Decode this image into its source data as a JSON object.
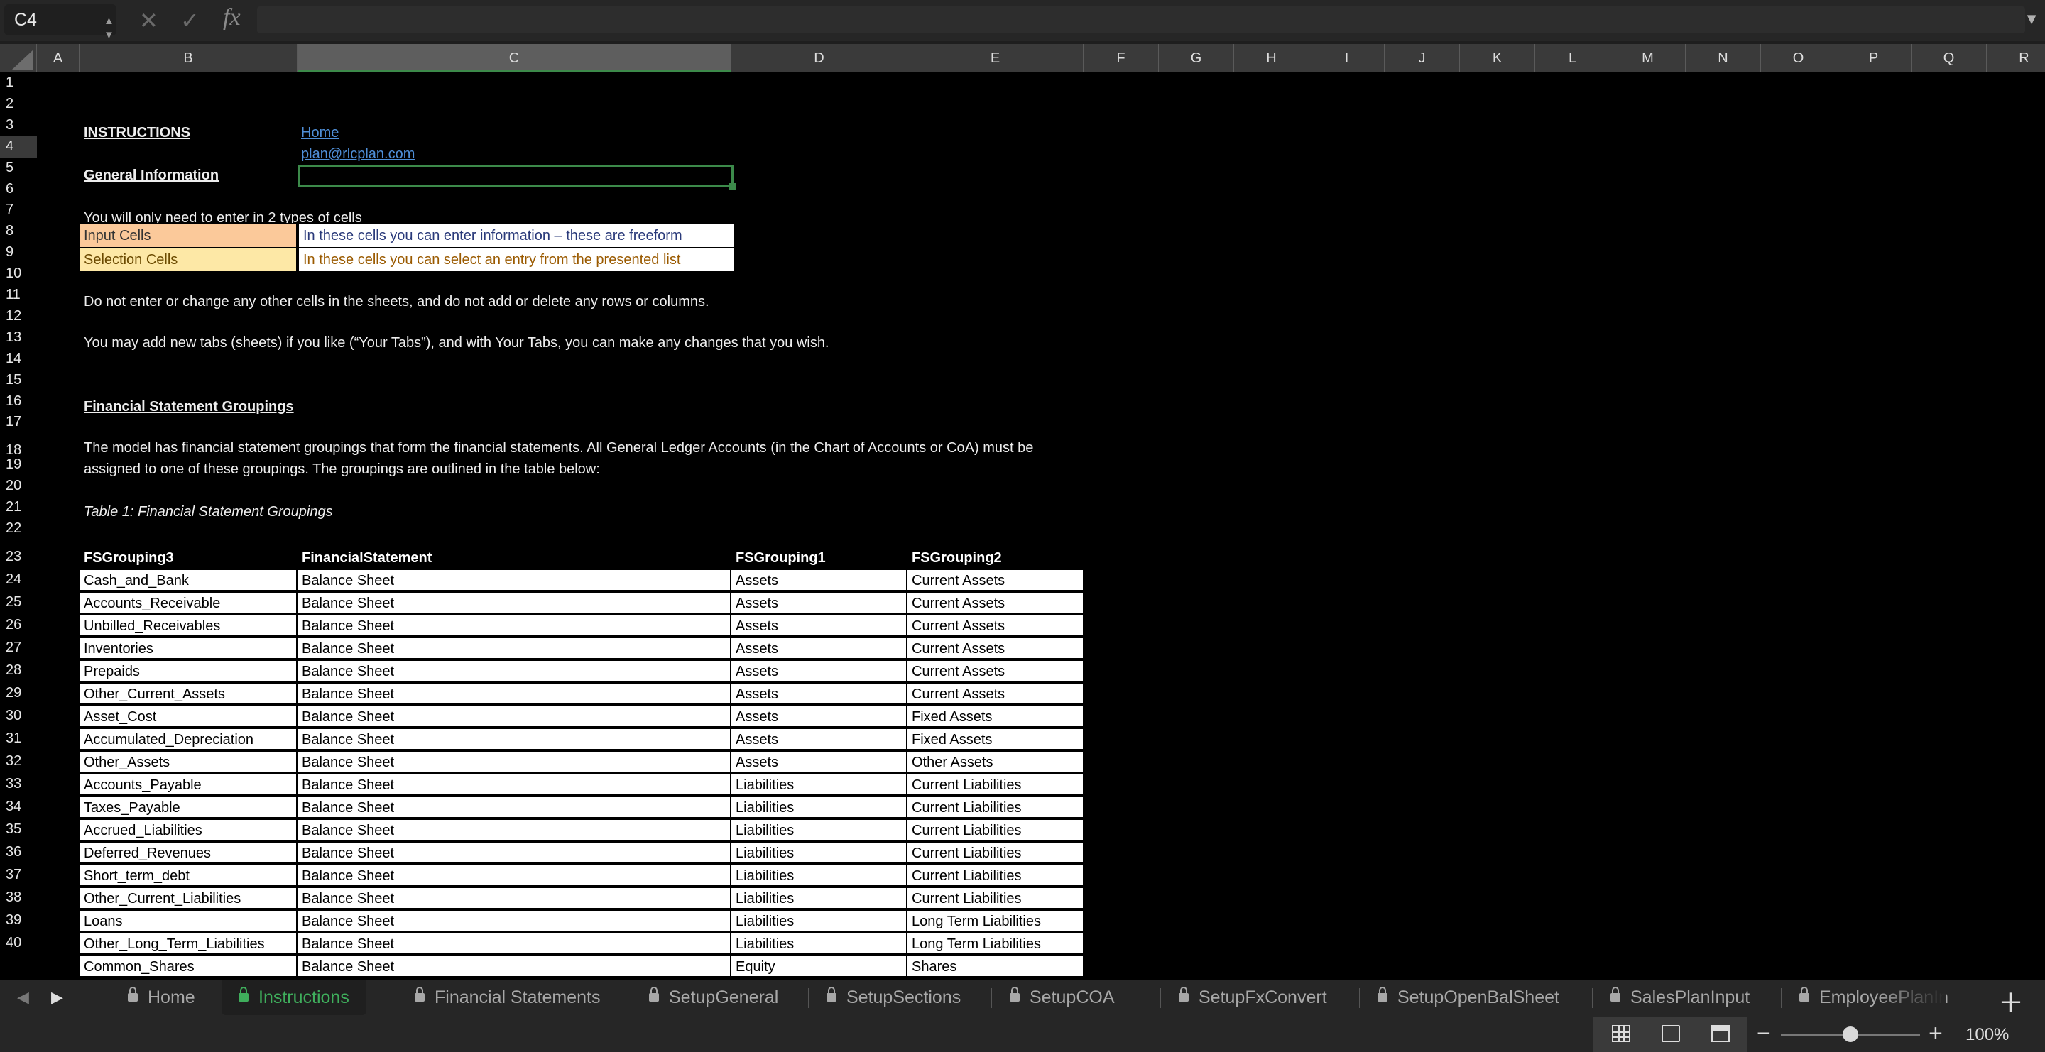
{
  "formula_bar": {
    "cell_ref": "C4",
    "fx_label": "fx",
    "formula": ""
  },
  "columns": [
    "A",
    "B",
    "C",
    "D",
    "E",
    "F",
    "G",
    "H",
    "I",
    "J",
    "K",
    "L",
    "M",
    "N",
    "O",
    "P",
    "Q",
    "R"
  ],
  "selected_column": "C",
  "rows": [
    "1",
    "2",
    "3",
    "4",
    "5",
    "6",
    "7",
    "8",
    "9",
    "10",
    "11",
    "12",
    "13",
    "14",
    "15",
    "16",
    "17",
    "18",
    "19",
    "20",
    "21",
    "22",
    "23",
    "24",
    "25",
    "26",
    "27",
    "28",
    "29",
    "30",
    "31",
    "32",
    "33",
    "34",
    "35",
    "36",
    "37",
    "38",
    "39",
    "40"
  ],
  "selected_row": "4",
  "content": {
    "instructions": "INSTRUCTIONS",
    "home_link": "Home",
    "email_link": "plan@rlcplan.com",
    "general_info": "General Information",
    "two_types": "You will only need to enter in 2 types of cells",
    "legend": {
      "input_label": "Input Cells",
      "input_desc": "In these cells you can enter information – these are freeform",
      "selection_label": "Selection Cells",
      "selection_desc": "In these cells you can select an entry from the presented list"
    },
    "do_not_enter": "Do not enter or change any other cells in the sheets, and do not add or delete any rows or columns.",
    "add_tabs": "You may add new tabs (sheets) if you like (“Your Tabs”), and with Your Tabs, you can make any changes that you wish.",
    "fs_heading": "Financial Statement Groupings",
    "para_line1": "The model has financial statement groupings that form the financial statements.  All General Ledger Accounts (in the Chart of Accounts or CoA) must be",
    "para_line2": "assigned to one of these groupings.  The groupings are outlined in the table below:",
    "table_caption": "Table 1: Financial Statement Groupings"
  },
  "table": {
    "headers": [
      "FSGrouping3",
      "FinancialStatement",
      "FSGrouping1",
      "FSGrouping2"
    ],
    "rows": [
      [
        "Cash_and_Bank",
        "Balance Sheet",
        "Assets",
        "Current Assets"
      ],
      [
        "Accounts_Receivable",
        "Balance Sheet",
        "Assets",
        "Current Assets"
      ],
      [
        "Unbilled_Receivables",
        "Balance Sheet",
        "Assets",
        "Current Assets"
      ],
      [
        "Inventories",
        "Balance Sheet",
        "Assets",
        "Current Assets"
      ],
      [
        "Prepaids",
        "Balance Sheet",
        "Assets",
        "Current Assets"
      ],
      [
        "Other_Current_Assets",
        "Balance Sheet",
        "Assets",
        "Current Assets"
      ],
      [
        "Asset_Cost",
        "Balance Sheet",
        "Assets",
        "Fixed Assets"
      ],
      [
        "Accumulated_Depreciation",
        "Balance Sheet",
        "Assets",
        "Fixed Assets"
      ],
      [
        "Other_Assets",
        "Balance Sheet",
        "Assets",
        "Other Assets"
      ],
      [
        "Accounts_Payable",
        "Balance Sheet",
        "Liabilities",
        "Current Liabilities"
      ],
      [
        "Taxes_Payable",
        "Balance Sheet",
        "Liabilities",
        "Current Liabilities"
      ],
      [
        "Accrued_Liabilities",
        "Balance Sheet",
        "Liabilities",
        "Current Liabilities"
      ],
      [
        "Deferred_Revenues",
        "Balance Sheet",
        "Liabilities",
        "Current Liabilities"
      ],
      [
        "Short_term_debt",
        "Balance Sheet",
        "Liabilities",
        "Current Liabilities"
      ],
      [
        "Other_Current_Liabilities",
        "Balance Sheet",
        "Liabilities",
        "Current Liabilities"
      ],
      [
        "Loans",
        "Balance Sheet",
        "Liabilities",
        "Long Term Liabilities"
      ],
      [
        "Other_Long_Term_Liabilities",
        "Balance Sheet",
        "Liabilities",
        "Long Term Liabilities"
      ],
      [
        "Common_Shares",
        "Balance Sheet",
        "Equity",
        "Shares"
      ]
    ]
  },
  "tabs": [
    {
      "label": "Home",
      "active": false
    },
    {
      "label": "Instructions",
      "active": true
    },
    {
      "label": "Financial Statements",
      "active": false
    },
    {
      "label": "SetupGeneral",
      "active": false
    },
    {
      "label": "SetupSections",
      "active": false
    },
    {
      "label": "SetupCOA",
      "active": false
    },
    {
      "label": "SetupFxConvert",
      "active": false
    },
    {
      "label": "SetupOpenBalSheet",
      "active": false
    },
    {
      "label": "SalesPlanInput",
      "active": false
    },
    {
      "label": "EmployeePlanIn",
      "active": false
    }
  ],
  "status": {
    "zoom": "100%",
    "zoom_level": 0.5
  },
  "colors": {
    "accent_green": "#3c8a4a",
    "input_cell": "#fbc99a",
    "selection_cell": "#fde8a6",
    "link": "#4f8fd8"
  }
}
